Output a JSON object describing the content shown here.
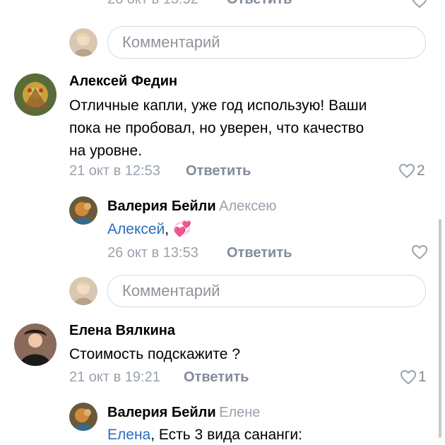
{
  "top_reply": {
    "date": "26 окт в 13:52",
    "reply_label": "Ответить"
  },
  "comment_input_1": {
    "placeholder": "Комментарий"
  },
  "comment_1": {
    "author": "Алексей Федин",
    "text_lines": [
      "Отличные капли, уже год использую! Ваши",
      "пока не пробовал, но уверен, что качество",
      "на уровне."
    ],
    "date": "21 окт в 12:53",
    "reply_label": "Ответить",
    "likes": "2"
  },
  "reply_1": {
    "author": "Валерия Бейли",
    "to": "Алексею",
    "mention": "Алексей",
    "text_after_mention": ",",
    "emoji": "💞",
    "date": "26 окт в 13:53",
    "reply_label": "Ответить"
  },
  "comment_input_2": {
    "placeholder": "Комментарий"
  },
  "comment_2": {
    "author": "Елена Вялкина",
    "text": "Стоимость подскажите ?",
    "date": "21 окт в 19:21",
    "reply_label": "Ответить",
    "likes": "1"
  },
  "reply_2": {
    "author": "Валерия Бейли",
    "to": "Елене",
    "mention": "Елена",
    "text_after_mention": ", Есть 3 вида сананги:"
  },
  "colors": {
    "link": "#2a6fb8",
    "meta": "#99a2ad",
    "border": "#d3d9de"
  }
}
